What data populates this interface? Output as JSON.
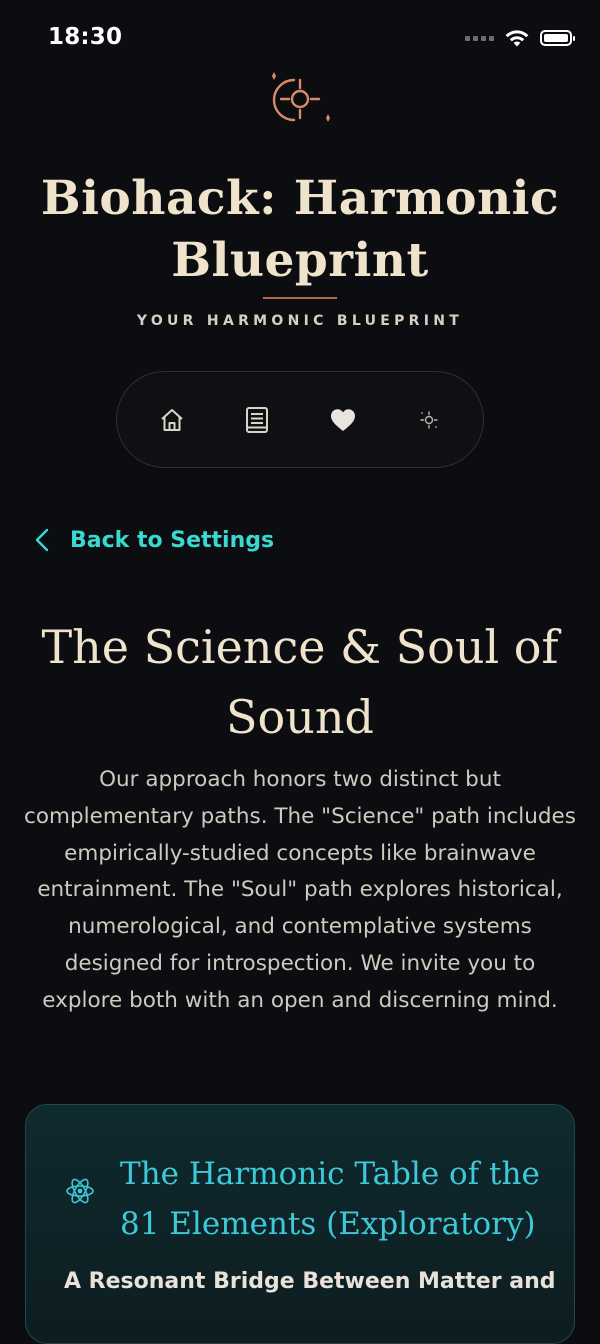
{
  "status_bar": {
    "time": "18:30"
  },
  "header": {
    "title": "Biohack: Harmonic Blueprint",
    "subtitle": "YOUR HARMONIC BLUEPRINT"
  },
  "nav": {
    "items": [
      {
        "icon": "home-icon"
      },
      {
        "icon": "book-icon"
      },
      {
        "icon": "heart-icon"
      },
      {
        "icon": "sun-target-icon"
      }
    ]
  },
  "back_link": {
    "label": "Back to Settings"
  },
  "section": {
    "title": "The Science & Soul of Sound",
    "body": "Our approach honors two distinct but complementary paths. The \"Science\" path includes empirically-studied concepts like brainwave entrainment. The \"Soul\" path explores historical, numerological, and contemplative systems designed for introspection. We invite you to explore both with an open and discerning mind."
  },
  "card": {
    "icon": "atom-icon",
    "title": "The Harmonic Table of the 81 Elements (Exploratory)",
    "subtitle": "A Resonant Bridge Between Matter and"
  },
  "colors": {
    "background": "#0c0d10",
    "accent_teal": "#39d9d0",
    "accent_copper": "#d88a6a",
    "heading_cream": "#efe3cc"
  }
}
